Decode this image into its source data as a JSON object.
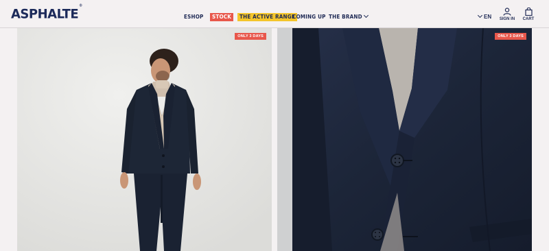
{
  "header": {
    "logo": "ASPHALTE",
    "logo_mark": "®",
    "nav": {
      "eshop": "ESHOP",
      "stock": "STOCK",
      "active_range": "THE ACTIVE RANGE",
      "coming_up": "COMING UP",
      "the_brand": "THE BRAND"
    },
    "language": "EN",
    "sign_in": "SIGN IN",
    "cart": "CART"
  },
  "products": [
    {
      "badge": "ONLY 3 DAYS",
      "image": "man-in-navy-suit-full-body"
    },
    {
      "badge": "ONLY 3 DAYS",
      "image": "navy-suit-jacket-closeup"
    }
  ],
  "colors": {
    "brand": "#1f2a55",
    "stock_badge": "#e8574b",
    "active_badge": "#f4c52b",
    "background": "#f4f1f2"
  }
}
